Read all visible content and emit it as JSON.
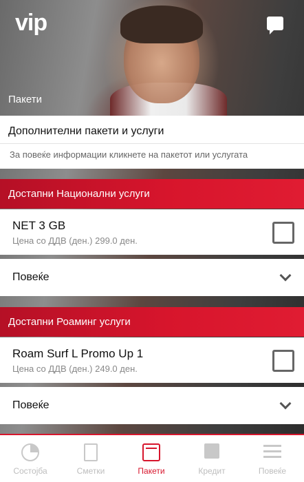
{
  "header": {
    "logo_text": "vip",
    "hero_title": "Пакети",
    "chat_icon": "chat-bubble-icon"
  },
  "info": {
    "title": "Дополнителни пакети и услуги",
    "subtitle": "За повеќе информации кликнете на пакетот или услугата"
  },
  "sections": [
    {
      "title": "Достапни Национални услуги",
      "package": {
        "name": "NET 3 GB",
        "price": "Цена со ДДВ (ден.) 299.0 ден.",
        "checked": false
      },
      "more_label": "Повеќе"
    },
    {
      "title": "Достапни Роаминг услуги",
      "package": {
        "name": "Roam Surf L Promo Up 1",
        "price": "Цена со ДДВ (ден.) 249.0 ден.",
        "checked": false
      },
      "more_label": "Повеќе"
    }
  ],
  "nav": {
    "items": [
      {
        "label": "Состојба",
        "icon": "pie-chart-icon"
      },
      {
        "label": "Сметки",
        "icon": "invoice-icon"
      },
      {
        "label": "Пакети",
        "icon": "package-icon",
        "active": true
      },
      {
        "label": "Кредит",
        "icon": "credit-icon"
      },
      {
        "label": "Повеќе",
        "icon": "menu-icon"
      }
    ]
  },
  "colors": {
    "accent": "#d7152c",
    "inactive": "#bdbdbd"
  }
}
